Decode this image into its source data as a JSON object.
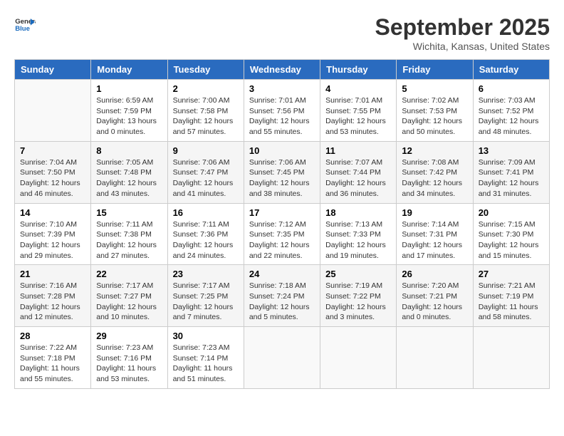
{
  "header": {
    "logo_line1": "General",
    "logo_line2": "Blue",
    "title": "September 2025",
    "subtitle": "Wichita, Kansas, United States"
  },
  "columns": [
    "Sunday",
    "Monday",
    "Tuesday",
    "Wednesday",
    "Thursday",
    "Friday",
    "Saturday"
  ],
  "weeks": [
    [
      {
        "day": "",
        "info": ""
      },
      {
        "day": "1",
        "info": "Sunrise: 6:59 AM\nSunset: 7:59 PM\nDaylight: 13 hours\nand 0 minutes."
      },
      {
        "day": "2",
        "info": "Sunrise: 7:00 AM\nSunset: 7:58 PM\nDaylight: 12 hours\nand 57 minutes."
      },
      {
        "day": "3",
        "info": "Sunrise: 7:01 AM\nSunset: 7:56 PM\nDaylight: 12 hours\nand 55 minutes."
      },
      {
        "day": "4",
        "info": "Sunrise: 7:01 AM\nSunset: 7:55 PM\nDaylight: 12 hours\nand 53 minutes."
      },
      {
        "day": "5",
        "info": "Sunrise: 7:02 AM\nSunset: 7:53 PM\nDaylight: 12 hours\nand 50 minutes."
      },
      {
        "day": "6",
        "info": "Sunrise: 7:03 AM\nSunset: 7:52 PM\nDaylight: 12 hours\nand 48 minutes."
      }
    ],
    [
      {
        "day": "7",
        "info": "Sunrise: 7:04 AM\nSunset: 7:50 PM\nDaylight: 12 hours\nand 46 minutes."
      },
      {
        "day": "8",
        "info": "Sunrise: 7:05 AM\nSunset: 7:48 PM\nDaylight: 12 hours\nand 43 minutes."
      },
      {
        "day": "9",
        "info": "Sunrise: 7:06 AM\nSunset: 7:47 PM\nDaylight: 12 hours\nand 41 minutes."
      },
      {
        "day": "10",
        "info": "Sunrise: 7:06 AM\nSunset: 7:45 PM\nDaylight: 12 hours\nand 38 minutes."
      },
      {
        "day": "11",
        "info": "Sunrise: 7:07 AM\nSunset: 7:44 PM\nDaylight: 12 hours\nand 36 minutes."
      },
      {
        "day": "12",
        "info": "Sunrise: 7:08 AM\nSunset: 7:42 PM\nDaylight: 12 hours\nand 34 minutes."
      },
      {
        "day": "13",
        "info": "Sunrise: 7:09 AM\nSunset: 7:41 PM\nDaylight: 12 hours\nand 31 minutes."
      }
    ],
    [
      {
        "day": "14",
        "info": "Sunrise: 7:10 AM\nSunset: 7:39 PM\nDaylight: 12 hours\nand 29 minutes."
      },
      {
        "day": "15",
        "info": "Sunrise: 7:11 AM\nSunset: 7:38 PM\nDaylight: 12 hours\nand 27 minutes."
      },
      {
        "day": "16",
        "info": "Sunrise: 7:11 AM\nSunset: 7:36 PM\nDaylight: 12 hours\nand 24 minutes."
      },
      {
        "day": "17",
        "info": "Sunrise: 7:12 AM\nSunset: 7:35 PM\nDaylight: 12 hours\nand 22 minutes."
      },
      {
        "day": "18",
        "info": "Sunrise: 7:13 AM\nSunset: 7:33 PM\nDaylight: 12 hours\nand 19 minutes."
      },
      {
        "day": "19",
        "info": "Sunrise: 7:14 AM\nSunset: 7:31 PM\nDaylight: 12 hours\nand 17 minutes."
      },
      {
        "day": "20",
        "info": "Sunrise: 7:15 AM\nSunset: 7:30 PM\nDaylight: 12 hours\nand 15 minutes."
      }
    ],
    [
      {
        "day": "21",
        "info": "Sunrise: 7:16 AM\nSunset: 7:28 PM\nDaylight: 12 hours\nand 12 minutes."
      },
      {
        "day": "22",
        "info": "Sunrise: 7:17 AM\nSunset: 7:27 PM\nDaylight: 12 hours\nand 10 minutes."
      },
      {
        "day": "23",
        "info": "Sunrise: 7:17 AM\nSunset: 7:25 PM\nDaylight: 12 hours\nand 7 minutes."
      },
      {
        "day": "24",
        "info": "Sunrise: 7:18 AM\nSunset: 7:24 PM\nDaylight: 12 hours\nand 5 minutes."
      },
      {
        "day": "25",
        "info": "Sunrise: 7:19 AM\nSunset: 7:22 PM\nDaylight: 12 hours\nand 3 minutes."
      },
      {
        "day": "26",
        "info": "Sunrise: 7:20 AM\nSunset: 7:21 PM\nDaylight: 12 hours\nand 0 minutes."
      },
      {
        "day": "27",
        "info": "Sunrise: 7:21 AM\nSunset: 7:19 PM\nDaylight: 11 hours\nand 58 minutes."
      }
    ],
    [
      {
        "day": "28",
        "info": "Sunrise: 7:22 AM\nSunset: 7:18 PM\nDaylight: 11 hours\nand 55 minutes."
      },
      {
        "day": "29",
        "info": "Sunrise: 7:23 AM\nSunset: 7:16 PM\nDaylight: 11 hours\nand 53 minutes."
      },
      {
        "day": "30",
        "info": "Sunrise: 7:23 AM\nSunset: 7:14 PM\nDaylight: 11 hours\nand 51 minutes."
      },
      {
        "day": "",
        "info": ""
      },
      {
        "day": "",
        "info": ""
      },
      {
        "day": "",
        "info": ""
      },
      {
        "day": "",
        "info": ""
      }
    ]
  ]
}
